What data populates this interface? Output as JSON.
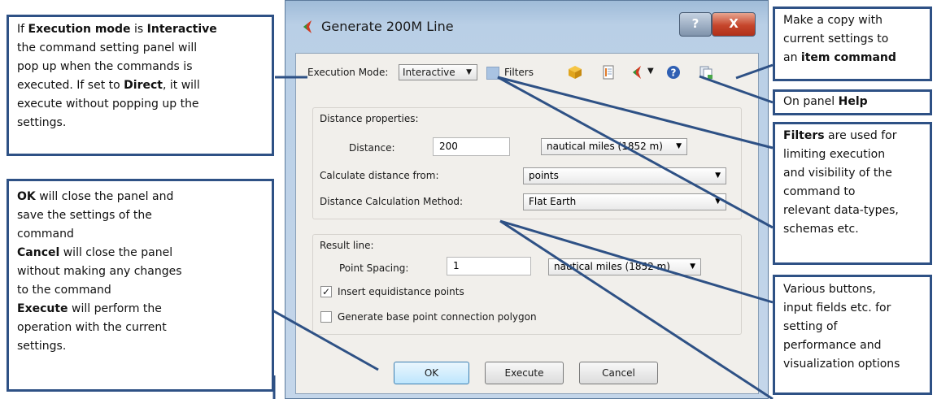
{
  "window": {
    "title": "Generate 200M Line",
    "help_glyph": "?",
    "close_glyph": "X"
  },
  "toolbar": {
    "execution_mode_label": "Execution Mode:",
    "execution_mode_value": "Interactive",
    "filters_label": "Filters"
  },
  "distance_group": {
    "title": "Distance properties:",
    "distance_label": "Distance:",
    "distance_value": "200",
    "distance_unit": "nautical miles (1852 m)",
    "calc_from_label": "Calculate distance from:",
    "calc_from_value": "points",
    "method_label": "Distance Calculation Method:",
    "method_value": "Flat Earth"
  },
  "result_group": {
    "title": "Result line:",
    "spacing_label": "Point Spacing:",
    "spacing_value": "1",
    "spacing_unit": "nautical miles (1852 m)",
    "insert_points_label": "Insert equidistance points",
    "insert_points_checked": true,
    "base_polygon_label": "Generate base point connection polygon",
    "base_polygon_checked": false
  },
  "buttons": {
    "ok": "OK",
    "execute": "Execute",
    "cancel": "Cancel"
  },
  "callouts": {
    "execution_mode": {
      "l1_b1": "Execution mode",
      "l1_t1": " is ",
      "l1_b2": "Interactive",
      "l2": "the command setting panel will",
      "l3": "pop up when the commands is",
      "l4_t1": "executed. If set to ",
      "l4_b1": "Direct",
      "l4_t2": ", it will",
      "l5": "execute without popping up the",
      "l6": "settings."
    },
    "buttons_help": {
      "l1_b": "OK",
      "l1_t": " will close the panel and",
      "l2": "save the settings of the",
      "l3": "command",
      "l4_b": "Cancel",
      "l4_t": " will close the panel",
      "l5": "without making any changes",
      "l6": "to the command",
      "l7_b": "Execute",
      "l7_t": " will perform the",
      "l8": "operation with the current",
      "l9": "settings."
    },
    "copy": {
      "l1": "Make a copy with",
      "l2": "current settings to",
      "l3_t": "an ",
      "l3_b": "item command"
    },
    "help": {
      "t": "On panel ",
      "b": "Help"
    },
    "filters": {
      "l1_b": "Filters",
      "l1_t": " are used for",
      "l2": "limiting execution",
      "l3": "and visibility of the",
      "l4": "command to",
      "l5": "relevant data-types,",
      "l6": "schemas etc."
    },
    "various": {
      "l1": "Various buttons,",
      "l2": "input fields etc. for",
      "l3": "setting of",
      "l4": "performance and",
      "l5": "visualization options"
    }
  },
  "colors": {
    "callout_border": "#2e5185",
    "close_button": "#c5452b",
    "window_frame": "#b9cfe6"
  }
}
